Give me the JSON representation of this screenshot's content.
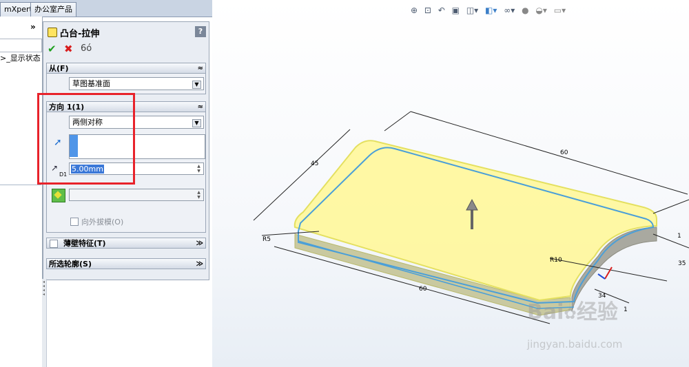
{
  "tabs": {
    "tab1": "mXpert",
    "tab2": "办公室产品"
  },
  "tree": {
    "chevron": "»",
    "item_text": ">_显示状态"
  },
  "pm": {
    "title": "凸台-拉伸",
    "help": "?",
    "actions": {
      "ok_symbol": "✔",
      "cancel_symbol": "✖",
      "preview_symbol": "6ó"
    },
    "from": {
      "header": "从(F)",
      "selected": "草图基准面"
    },
    "direction1": {
      "header": "方向 1(1)",
      "end_condition": "两侧对称",
      "depth_value": "5.00mm",
      "depth_icon_label": "D1",
      "draft_outward_label": "向外拔模(O)"
    },
    "thin_feature": {
      "header": "薄壁特征(T)"
    },
    "selected_contours": {
      "header": "所选轮廓(S)"
    },
    "collapse_symbol": "≈",
    "expand_symbol": "≫"
  },
  "model": {
    "dim_top_length": "60",
    "dim_bottom_length": "60",
    "dim_left": "45",
    "dim_r5": "R5",
    "dim_r10": "R10",
    "dim_34": "34",
    "dim_right_1": "1",
    "dim_right_2": "35",
    "dim_bottom_right": "1"
  },
  "watermark": {
    "brand": "Bai",
    "brand2": "经验",
    "url": "jingyan.baidu.com"
  },
  "colors": {
    "highlight": "#e8222a",
    "feature_fill": "#fff79a",
    "edge": "#4a9fd8",
    "selection": "#3b78d8"
  }
}
